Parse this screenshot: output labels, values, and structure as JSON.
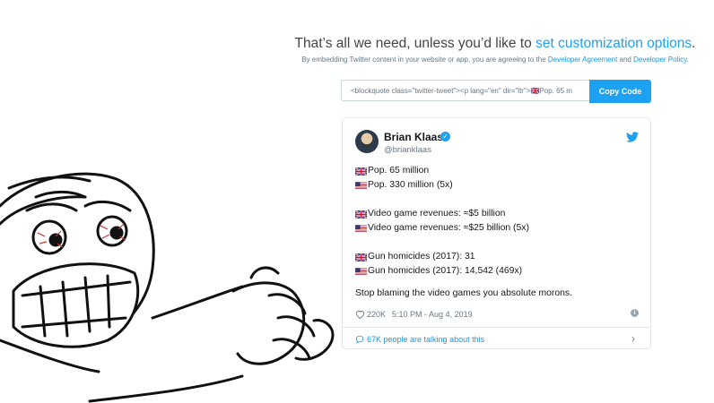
{
  "header": {
    "headline_prefix": "That’s all we need, unless you’d like to ",
    "headline_link": "set customization options",
    "headline_suffix": ".",
    "sub_prefix": "By embedding Twitter content in your website or app, you are agreeing to the ",
    "sub_link1": "Developer Agreement",
    "sub_mid": " and ",
    "sub_link2": "Developer Policy",
    "sub_suffix": "."
  },
  "embed": {
    "code": "<blockquote class=\"twitter-tweet\"><p lang=\"en\" dir=\"ltr\">🇬🇧Pop. 65 m",
    "copy_label": "Copy Code"
  },
  "tweet": {
    "author_name": "Brian Klaas",
    "handle": "@brianklaas",
    "lines": [
      "Pop. 65 million",
      "Pop. 330 million (5x)",
      "Video game revenues: ≈$5 billion",
      "Video game revenues: ≈$25 billion (5x)",
      "Gun homicides (2017): 31",
      "Gun homicides (2017): 14,542 (469x)"
    ],
    "closing": "Stop blaming the video games you absolute morons.",
    "likes": "220K",
    "timestamp": "5:10 PM - Aug 4, 2019",
    "talking": "67K people are talking about this"
  },
  "icons": {
    "verified": "verified-badge-icon",
    "bird": "twitter-bird-icon",
    "heart": "heart-icon",
    "info": "info-icon",
    "comment": "comment-bubble-icon",
    "chevron": "chevron-right-icon",
    "uk_flag": "uk-flag-icon",
    "us_flag": "us-flag-icon"
  },
  "colors": {
    "twitter_blue": "#1da1f2",
    "link_blue": "#1b95e0",
    "muted": "#657786"
  }
}
